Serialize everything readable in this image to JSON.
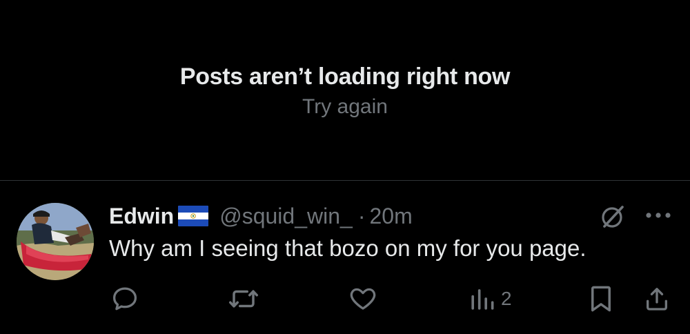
{
  "error": {
    "title": "Posts aren’t loading right now",
    "retry_label": "Try again"
  },
  "tweet": {
    "author_name": "Edwin",
    "author_flag_icon": "el-salvador-flag-icon",
    "handle": "@squid_win_",
    "separator": "·",
    "time": "20m",
    "text": "Why am I seeing that bozo on my for you page.",
    "actions": {
      "reply_icon": "reply-icon",
      "repost_icon": "repost-icon",
      "like_icon": "heart-icon",
      "views_icon": "views-bar-icon",
      "views_count": "2",
      "bookmark_icon": "bookmark-icon",
      "share_icon": "share-icon"
    },
    "header_icons": {
      "grok": "grok-icon",
      "more": "more-dots-icon"
    }
  },
  "colors": {
    "background": "#000000",
    "primary_text": "#e7e9ea",
    "secondary_text": "#71767b",
    "divider": "#2f3336"
  }
}
